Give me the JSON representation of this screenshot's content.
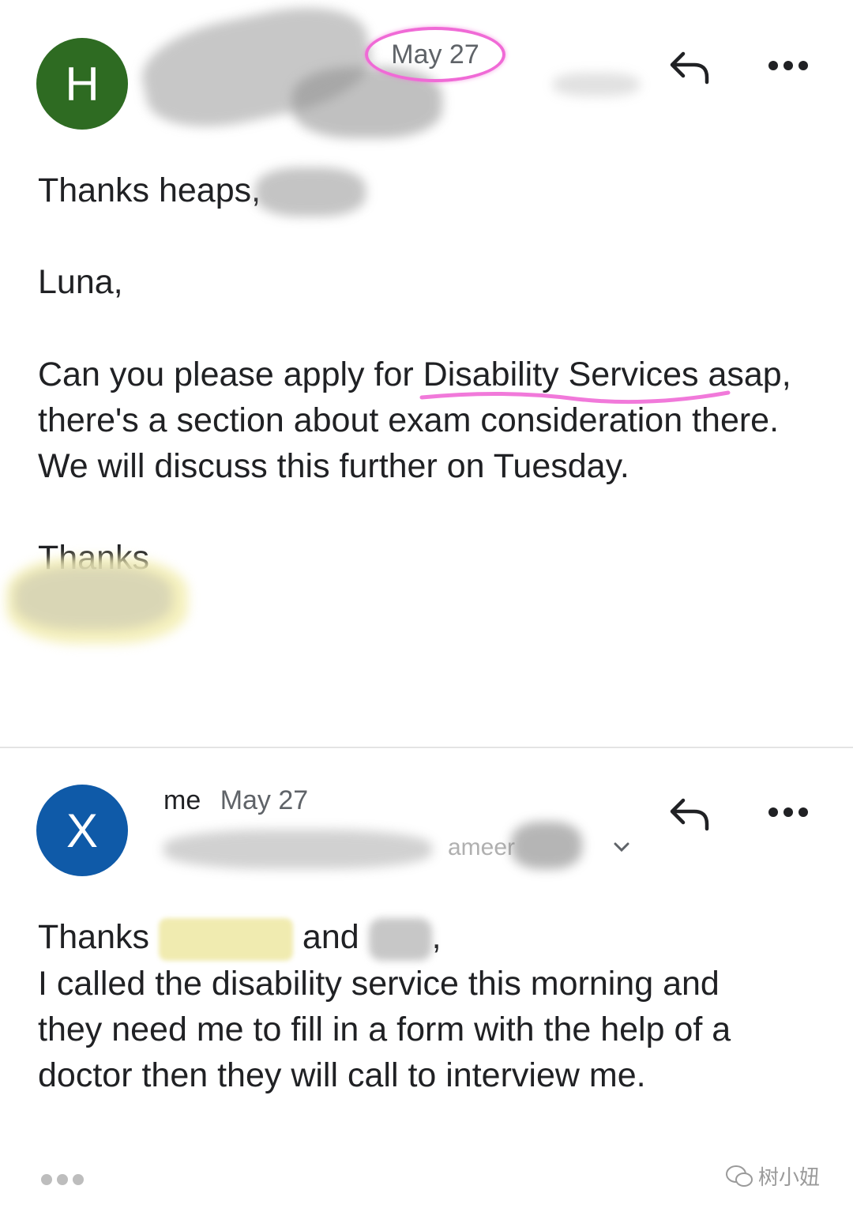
{
  "message1": {
    "avatar_letter": "H",
    "avatar_color": "#2e6b22",
    "date": "May 27",
    "greeting": "Thanks heaps,",
    "salutation": "Luna,",
    "para_before_highlight": "Can you please apply for ",
    "highlight": "Disability Services",
    "para_after_highlight": " asap, there's a section about exam consideration there. We will discuss this further on Tuesday.",
    "signoff": "Thanks",
    "reply_icon": "reply-icon",
    "more_icon": "more-vert-icon"
  },
  "message2": {
    "avatar_letter": "X",
    "avatar_color": "#0f5aa8",
    "sender": "me",
    "date": "May 27",
    "recipients_fragment": "ameer",
    "greeting_start": "Thanks",
    "greeting_and": "and",
    "greeting_end": ",",
    "body": "I called the disability service this morning and they need me to fill in a form with the help of a doctor then they will call to interview me.",
    "reply_icon": "reply-icon",
    "more_icon": "more-vert-icon",
    "expand_icon": "chevron-down-icon"
  },
  "watermark": "树小妞",
  "colors": {
    "highlight_pink": "#f06ad6",
    "redaction_grey": "#8a8a8a",
    "redaction_yellow": "#f4efb6"
  }
}
